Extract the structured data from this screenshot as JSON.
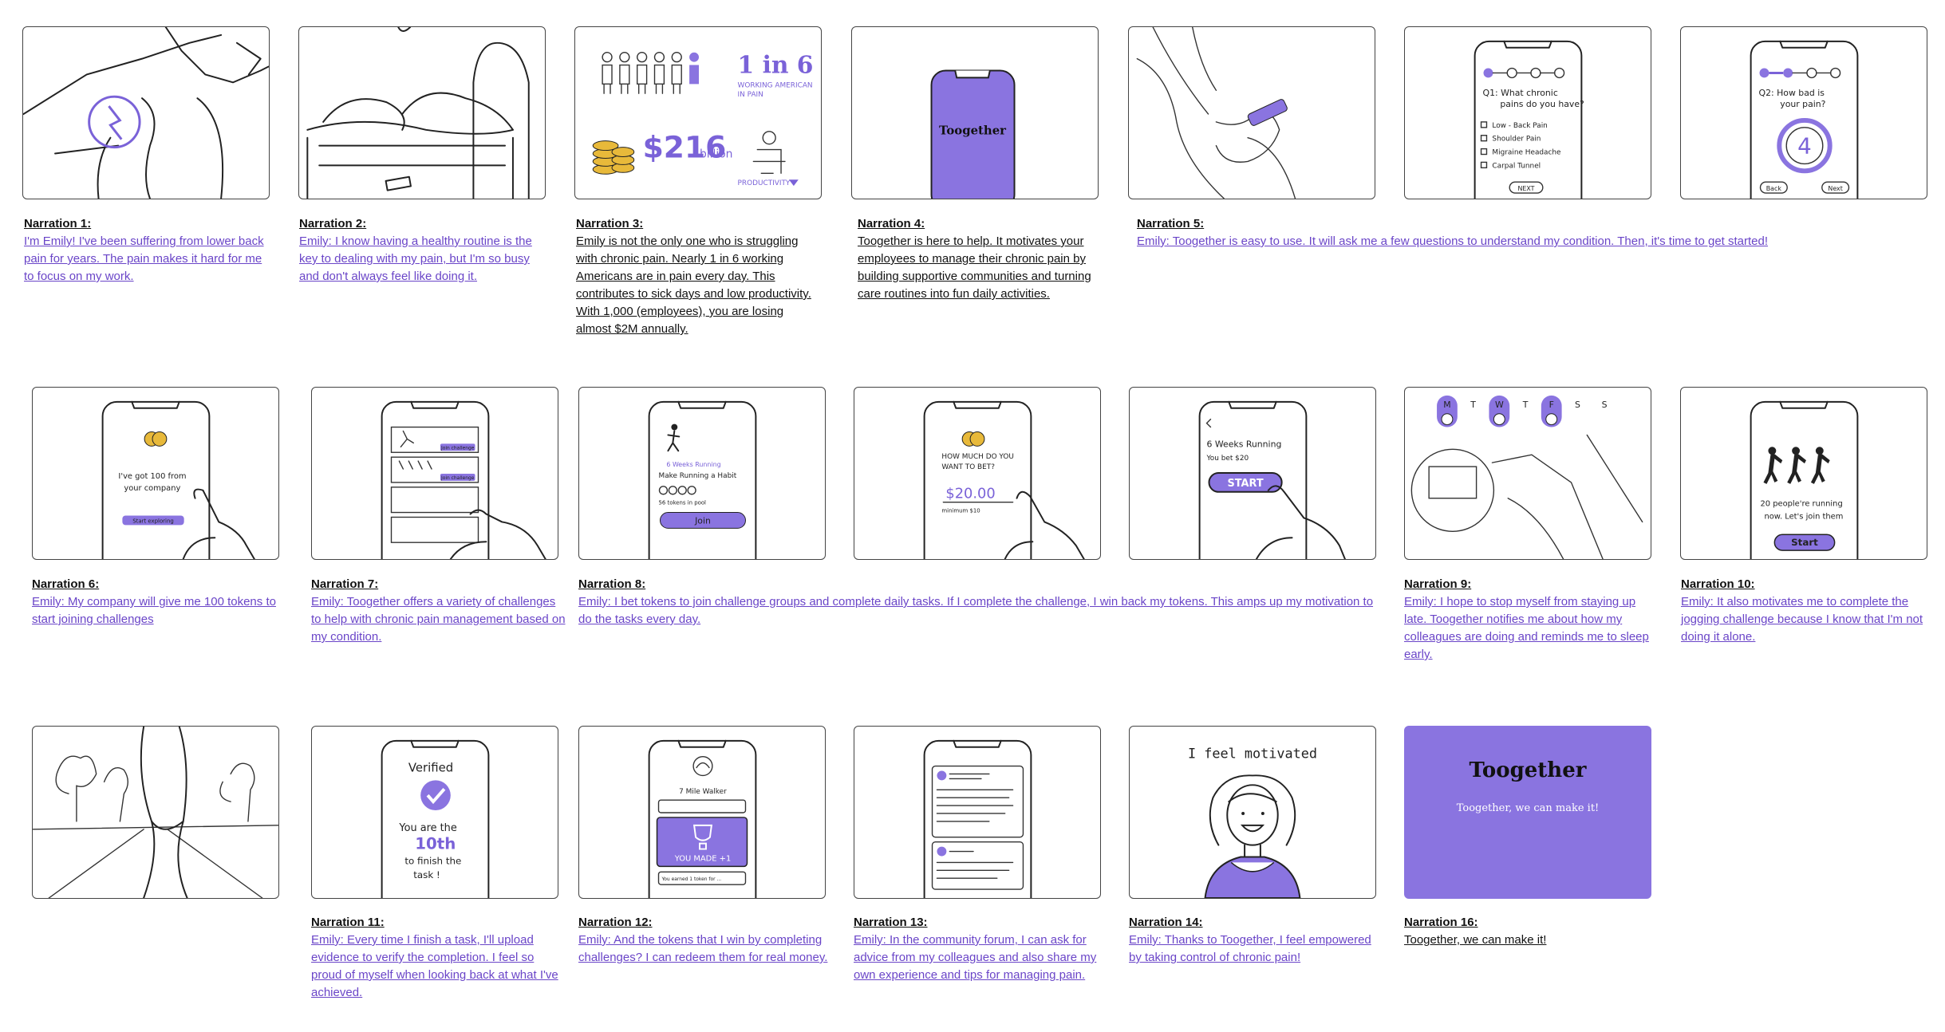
{
  "panels": [
    {
      "id": "p1",
      "title": "Narration 1:",
      "text": "I'm Emily! I've been suffering from lower back pain for years. The pain makes it hard for me to focus on my work."
    },
    {
      "id": "p2",
      "title": "Narration 2:",
      "text": "Emily: I know having a healthy routine is the key to dealing with my pain, but I'm so busy and don't always feel like doing it."
    },
    {
      "id": "p3",
      "title": "Narration 3:",
      "text": "Emily is not the only one who is struggling with chronic pain. Nearly 1 in 6 working Americans are in pain every day.  This contributes to sick days and low productivity. With 1,000 (employees), you are losing almost $2M annually.",
      "sketch": {
        "stat_ratio": "1 in 6",
        "stat_sub1": "WORKING AMERICAN",
        "stat_sub2": "IN PAIN",
        "money": "$216",
        "money_unit": "billion",
        "productivity": "PRODUCTIVITY"
      }
    },
    {
      "id": "p4",
      "title": "Narration 4:",
      "text": "Toogether is here to help. It motivates your employees to manage their chronic pain by building supportive communities and turning care routines into fun daily activities.",
      "sketch": {
        "logo": "Toogether"
      }
    },
    {
      "id": "p5",
      "title": "Narration 5:",
      "text": "Emily: Toogether is easy to use. It will ask me a few questions to understand my condition. Then, it's time to get started!"
    },
    {
      "id": "p6",
      "sketch": {
        "q": "Q1: What chronic",
        "q2": "pains do you have?",
        "opts": [
          "Low - Back Pain",
          "Shoulder Pain",
          "Migraine Headache",
          "Carpal Tunnel"
        ],
        "next": "NEXT"
      }
    },
    {
      "id": "p7",
      "sketch": {
        "q": "Q2: How bad is",
        "q2": "your pain?",
        "value": "4",
        "back": "Back",
        "next": "Next"
      }
    },
    {
      "id": "p8",
      "title": "Narration 6:",
      "text": "Emily: My company will give me 100 tokens to start joining challenges",
      "sketch": {
        "l1": "I've got 100 from",
        "l2": "your company",
        "btn": "Start exploring"
      }
    },
    {
      "id": "p9",
      "title": "Narration 7:",
      "text": "Emily:  Toogether offers a variety of challenges to help with chronic pain management based on my condition.",
      "sketch": {
        "tag": "Join challenge",
        "tag2": "Join challenge"
      }
    },
    {
      "id": "p10",
      "title": "Narration 8:",
      "text": "Emily:  I bet tokens to join challenge groups and complete daily tasks. If I complete the challenge, I win back my tokens. This amps up my motivation to do the tasks every day.",
      "sketch": {
        "l1": "6 Weeks Running",
        "l2": "Make Running a Habit",
        "l3": "56 tokens in pool",
        "join": "Join"
      }
    },
    {
      "id": "p11",
      "sketch": {
        "l1": "HOW MUCH DO YOU",
        "l2": "WANT TO BET?",
        "amount": "$20.00",
        "min": "minimum $10"
      }
    },
    {
      "id": "p12",
      "sketch": {
        "l1": "6 Weeks Running",
        "l2": "You bet $20",
        "start": "START"
      }
    },
    {
      "id": "p13",
      "title": "Narration 9:",
      "text": "Emily: I hope to stop myself from staying up late. Toogether notifies me about how my colleagues are doing and reminds me to sleep early.",
      "sketch": {
        "days": [
          "M",
          "T",
          "W",
          "T",
          "F",
          "S",
          "S"
        ]
      }
    },
    {
      "id": "p14",
      "title": "Narration 10:",
      "text": "Emily: It also motivates me to complete the jogging challenge because I know that I'm not doing it alone.",
      "sketch": {
        "l1": "20 people're running",
        "l2": "now. Let's join them",
        "start": "Start"
      }
    },
    {
      "id": "p15"
    },
    {
      "id": "p16",
      "title": "Narration 11:",
      "text": "Emily: Every time I finish a task, I'll upload evidence to verify the completion. I feel so proud of myself when looking back at what I've achieved.",
      "sketch": {
        "verified": "Verified",
        "l1": "You are the",
        "rank": "10th",
        "l2": "to finish the",
        "l3": "task !"
      }
    },
    {
      "id": "p17",
      "title": "Narration 12:",
      "text": "Emily:  And the tokens that I win by completing challenges? I can redeem them for real money.",
      "sketch": {
        "l1": "7 Mile Walker",
        "made": "YOU MADE +1",
        "foot": "You earned 1 token for ..."
      }
    },
    {
      "id": "p18",
      "title": "Narration 13:",
      "text": "Emily:  In the community forum, I can ask for advice from my colleagues and also share my own experience and tips for managing pain."
    },
    {
      "id": "p19",
      "title": "Narration 14:",
      "text": "Emily:  Thanks to Toogether, I feel empowered by taking control of chronic pain!",
      "sketch": {
        "caption": "I feel motivated"
      }
    },
    {
      "id": "p20",
      "title": "Narration 16:",
      "text": "Toogether, we can make it!",
      "sketch": {
        "logo": "Toogether",
        "tagline": "Toogether, we can make it!"
      }
    }
  ],
  "colors": {
    "accent": "#8a74e0",
    "link": "#6a45c8",
    "ink": "#222222"
  }
}
